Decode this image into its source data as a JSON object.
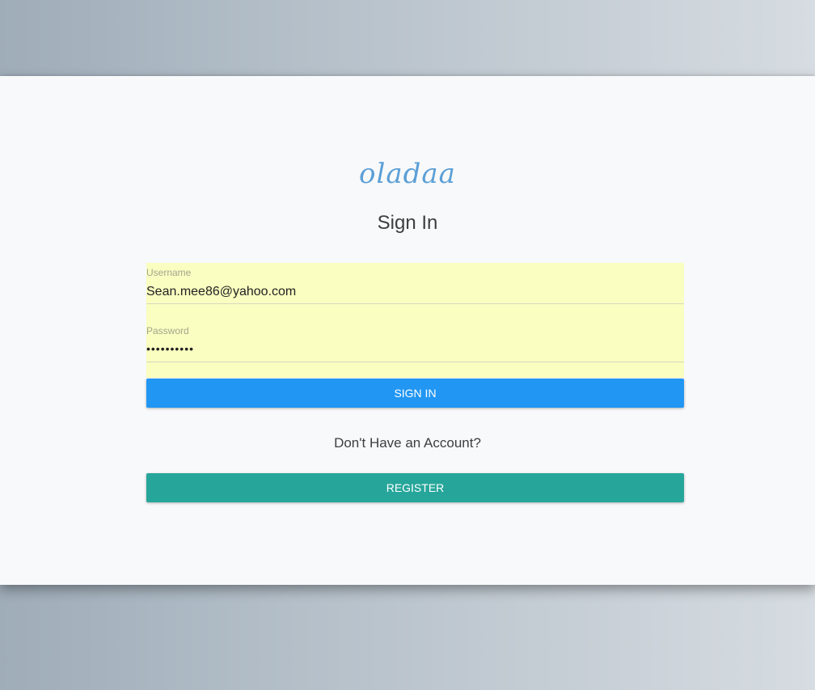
{
  "brand": {
    "logo_text": "oladaa",
    "logo_color": "#5b9fd6"
  },
  "form": {
    "title": "Sign In",
    "username": {
      "label": "Username",
      "value": "Sean.mee86@yahoo.com"
    },
    "password": {
      "label": "Password",
      "value": "••••••••••"
    },
    "signin_label": "SIGN IN",
    "signin_color": "#2196f3"
  },
  "register": {
    "prompt": "Don't Have an Account?",
    "button_label": "REGISTER",
    "button_color": "#26a69a"
  },
  "autofill_color": "#fafec0"
}
